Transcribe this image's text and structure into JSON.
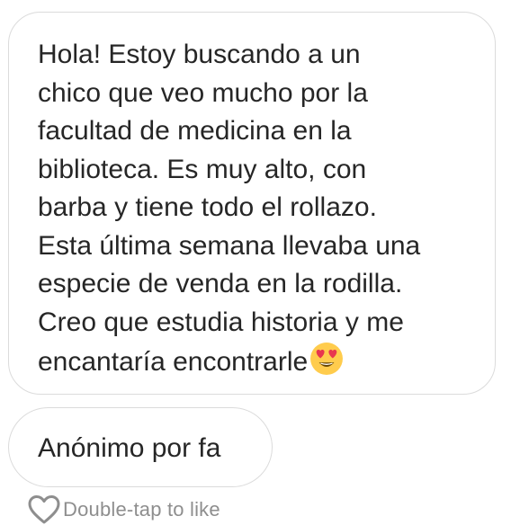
{
  "messages": [
    {
      "text": "Hola! Estoy buscando a un\nchico que veo mucho por la\nfacultad de medicina en la\nbiblioteca. Es muy alto, con\nbarba y tiene todo el rollazo.\nEsta última semana llevaba una\nespecie de venda en la rodilla.\nCreo que estudia historia y me\nencantaría encontrarle",
      "trailing_emoji": "heart-eyes-emoji"
    },
    {
      "text": "Anónimo por fa"
    }
  ],
  "footer": {
    "icon": "heart-outline-icon",
    "hint": "Double-tap to like"
  },
  "colors": {
    "text": "#262626",
    "border": "#dbdbdb",
    "hint": "#8e8e8e",
    "emoji_face": "#ffcc4d",
    "emoji_hearts": "#e8364f"
  }
}
